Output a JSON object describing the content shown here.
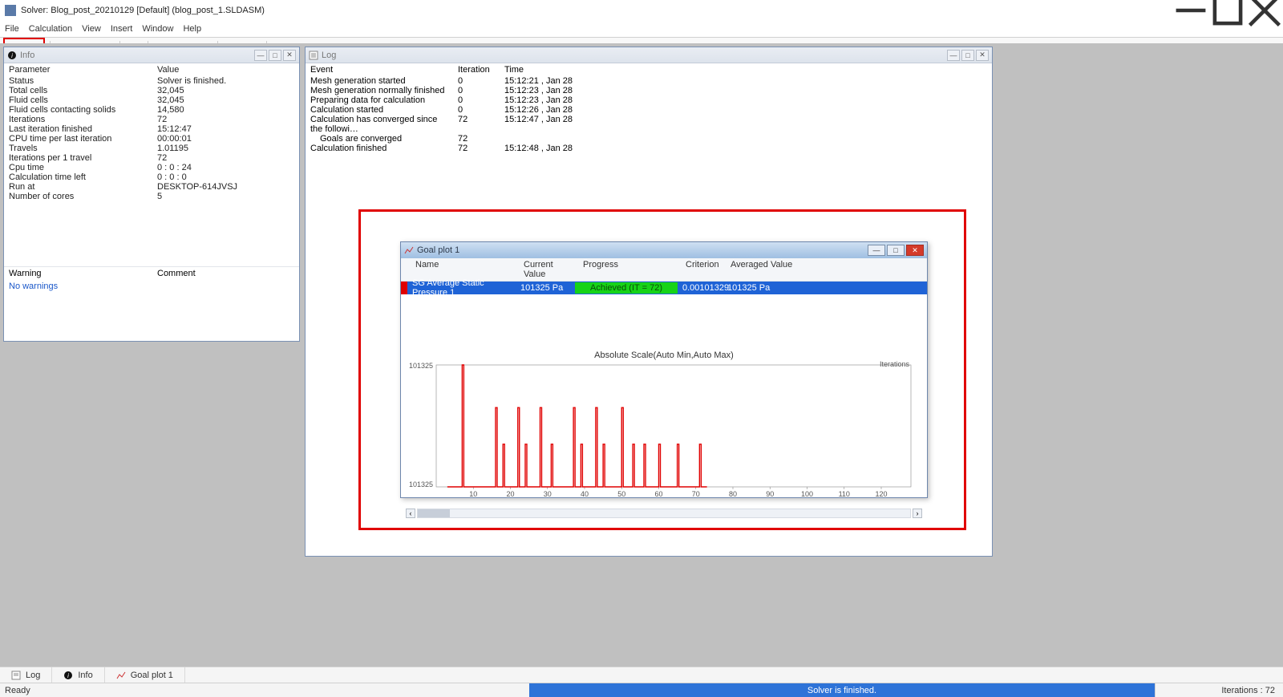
{
  "window": {
    "title": "Solver: Blog_post_20210129 [Default] (blog_post_1.SLDASM)"
  },
  "menu": {
    "file": "File",
    "calculation": "Calculation",
    "view": "View",
    "insert": "Insert",
    "window": "Window",
    "help": "Help"
  },
  "panels": {
    "info": {
      "title": "Info",
      "param_header": "Parameter",
      "value_header": "Value",
      "rows": [
        {
          "k": "Status",
          "v": "Solver is finished."
        },
        {
          "k": "Total cells",
          "v": "32,045"
        },
        {
          "k": "Fluid cells",
          "v": "32,045"
        },
        {
          "k": "Fluid cells contacting solids",
          "v": "14,580"
        },
        {
          "k": "Iterations",
          "v": "72"
        },
        {
          "k": "Last iteration finished",
          "v": "15:12:47"
        },
        {
          "k": "CPU time per last iteration",
          "v": "00:00:01"
        },
        {
          "k": "Travels",
          "v": "1.01195"
        },
        {
          "k": "Iterations per 1 travel",
          "v": "72"
        },
        {
          "k": "Cpu time",
          "v": "0 : 0 : 24"
        },
        {
          "k": "Calculation time left",
          "v": "0 : 0 : 0"
        },
        {
          "k": "Run at",
          "v": "DESKTOP-614JVSJ"
        },
        {
          "k": "Number of cores",
          "v": "5"
        }
      ],
      "warning_header": "Warning",
      "comment_header": "Comment",
      "warning_text": "No warnings"
    },
    "log": {
      "title": "Log",
      "event_header": "Event",
      "iteration_header": "Iteration",
      "time_header": "Time",
      "rows": [
        {
          "e": "Mesh generation started",
          "i": "0",
          "t": "15:12:21 , Jan 28"
        },
        {
          "e": "Mesh generation normally finished",
          "i": "0",
          "t": "15:12:23 , Jan 28"
        },
        {
          "e": "Preparing data for calculation",
          "i": "0",
          "t": "15:12:23 , Jan 28"
        },
        {
          "e": "Calculation started",
          "i": "0",
          "t": "15:12:26 , Jan 28"
        },
        {
          "e": "Calculation has converged since the followi…",
          "i": "72",
          "t": "15:12:47 , Jan 28"
        },
        {
          "e": "Goals are converged",
          "i": "72",
          "t": "",
          "indent": true
        },
        {
          "e": "Calculation finished",
          "i": "72",
          "t": "15:12:48 , Jan 28"
        }
      ]
    }
  },
  "goal_plot": {
    "title": "Goal plot 1",
    "headers": {
      "name": "Name",
      "current": "Current Value",
      "progress": "Progress",
      "criterion": "Criterion",
      "averaged": "Averaged Value"
    },
    "row": {
      "name": "SG Average Static Pressure 1",
      "current": "101325 Pa",
      "progress": "Achieved (IT = 72)",
      "criterion": "0.00101329",
      "averaged": "101325 Pa"
    },
    "chart_title": "Absolute Scale(Auto Min,Auto Max)",
    "y_tick_top": "101325",
    "y_tick_bottom": "101325",
    "x_label": "Iterations"
  },
  "chart_data": {
    "type": "line",
    "title": "Absolute Scale(Auto Min,Auto Max)",
    "xlabel": "Iterations",
    "ylabel": "",
    "x_ticks": [
      10,
      20,
      30,
      40,
      50,
      60,
      70,
      80,
      90,
      100,
      110,
      120
    ],
    "y_ticks_labels": [
      "101325",
      "101325"
    ],
    "ylim_label_note": "min and max labels both read 101325",
    "series": [
      {
        "name": "SG Average Static Pressure 1",
        "color": "#e00000",
        "x": [
          5,
          6,
          7,
          8,
          9,
          10,
          15,
          16,
          17,
          18,
          21,
          22,
          23,
          24,
          27,
          28,
          29,
          30,
          31,
          36,
          37,
          38,
          39,
          42,
          43,
          44,
          45,
          49,
          50,
          51,
          52,
          53,
          54,
          55,
          56,
          57,
          59,
          60,
          61,
          62,
          64,
          65,
          66,
          67,
          70,
          71,
          72
        ],
        "y_rel": [
          0,
          0,
          1.0,
          0,
          0,
          0,
          0,
          0.65,
          0,
          0.35,
          0,
          0.65,
          0,
          0.35,
          0,
          0.65,
          0,
          0,
          0.35,
          0,
          0.65,
          0,
          0.35,
          0,
          0.65,
          0,
          0.35,
          0,
          0.65,
          0,
          0,
          0.35,
          0,
          0,
          0.35,
          0,
          0,
          0.35,
          0,
          0,
          0,
          0.35,
          0,
          0,
          0,
          0.35,
          0
        ],
        "note": "y_rel is normalized 0..1 between the two 101325 tick labels; absolute Pa values not readable"
      }
    ]
  },
  "tabs": {
    "log": "Log",
    "info": "Info",
    "goal": "Goal plot 1"
  },
  "status": {
    "ready": "Ready",
    "mid": "Solver is finished.",
    "right": "Iterations : 72"
  }
}
